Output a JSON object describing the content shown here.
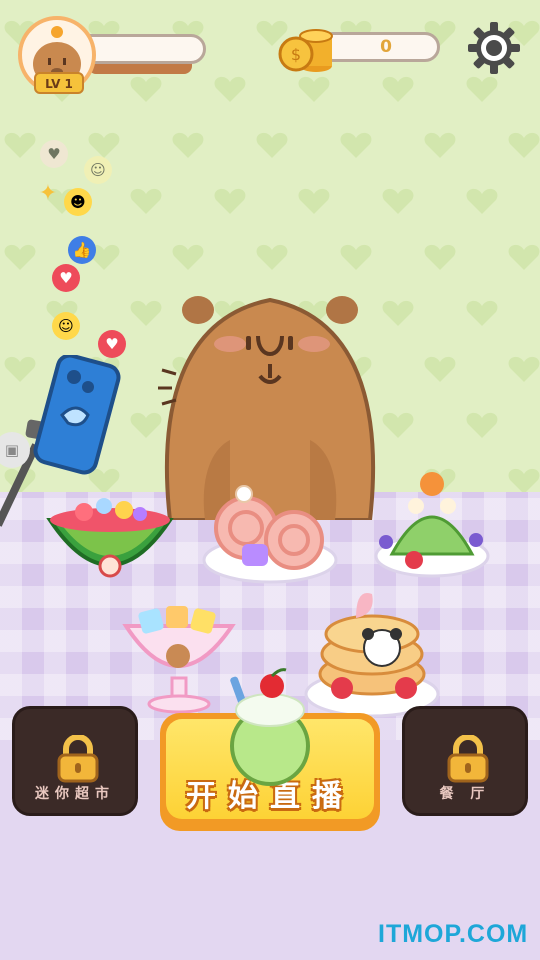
{
  "player": {
    "level_label": "LV 1"
  },
  "currency": {
    "coins": "0"
  },
  "icons": {
    "settings": "gear-icon",
    "coin": "coin-stack-icon",
    "lock": "padlock-icon"
  },
  "reactions": [
    "heart",
    "grinning-face",
    "sparkles",
    "sunglasses-face",
    "thumbs-up",
    "heart",
    "tears-of-joy-face",
    "heart",
    "camera"
  ],
  "desserts": [
    "watermelon-fruit-bowl",
    "strawberry-swiss-rolls",
    "melon-jelly-parfait",
    "fruit-jelly-sundae",
    "panda-pancake-stack",
    "melon-soda-float"
  ],
  "buttons": {
    "mini_market": "迷你超市",
    "start_stream": "开始直播",
    "restaurant": "餐 厅"
  },
  "watermark": "ITMOP.COM",
  "colors": {
    "wall": "#e1efc4",
    "floor": "#d9c9ec",
    "start_button": "#fdd235",
    "accent": "#f29a25"
  }
}
